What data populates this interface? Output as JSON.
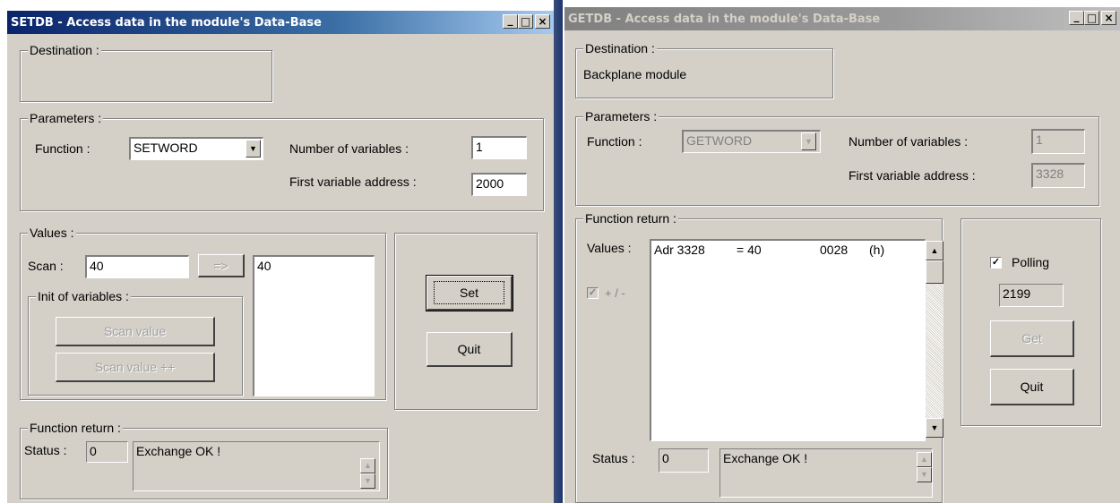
{
  "setdb": {
    "title": "SETDB - Access data in the module's Data-Base",
    "controls": {
      "minimize": "_",
      "maximize": "□",
      "close": "×"
    },
    "destination": {
      "label": "Destination :",
      "value": ""
    },
    "parameters": {
      "label": "Parameters :",
      "function_label": "Function :",
      "function_value": "SETWORD",
      "num_vars_label": "Number of variables :",
      "num_vars_value": "1",
      "first_addr_label": "First variable address :",
      "first_addr_value": "2000"
    },
    "values": {
      "label": "Values :",
      "scan_label": "Scan :",
      "scan_value": "40",
      "arrow_button": "=>",
      "list_items": [
        "40"
      ],
      "init_label": "Init of variables :",
      "scan_value_button": "Scan value",
      "scan_value_pp_button": "Scan value ++"
    },
    "buttons": {
      "set": "Set",
      "quit": "Quit"
    },
    "function_return": {
      "label": "Function return :",
      "status_label": "Status :",
      "status_code": "0",
      "status_text": "Exchange OK !"
    }
  },
  "getdb": {
    "title": "GETDB - Access data in the module's Data-Base",
    "controls": {
      "minimize": "_",
      "maximize": "□",
      "close": "×"
    },
    "destination": {
      "label": "Destination :",
      "value": "Backplane module"
    },
    "parameters": {
      "label": "Parameters :",
      "function_label": "Function :",
      "function_value": "GETWORD",
      "num_vars_label": "Number of variables :",
      "num_vars_value": "1",
      "first_addr_label": "First variable address :",
      "first_addr_value": "3328"
    },
    "function_return": {
      "label": "Function return :",
      "values_label": "Values :",
      "value_row": {
        "adr": "Adr 3328",
        "eq": "= 40",
        "hex": "0028",
        "unit": "(h)"
      },
      "plus_minus_label": "+ / -",
      "status_label": "Status :",
      "status_code": "0",
      "status_text": "Exchange OK !"
    },
    "polling": {
      "label": "Polling",
      "checked": true,
      "value": "2199"
    },
    "buttons": {
      "get": "Get",
      "quit": "Quit"
    }
  }
}
